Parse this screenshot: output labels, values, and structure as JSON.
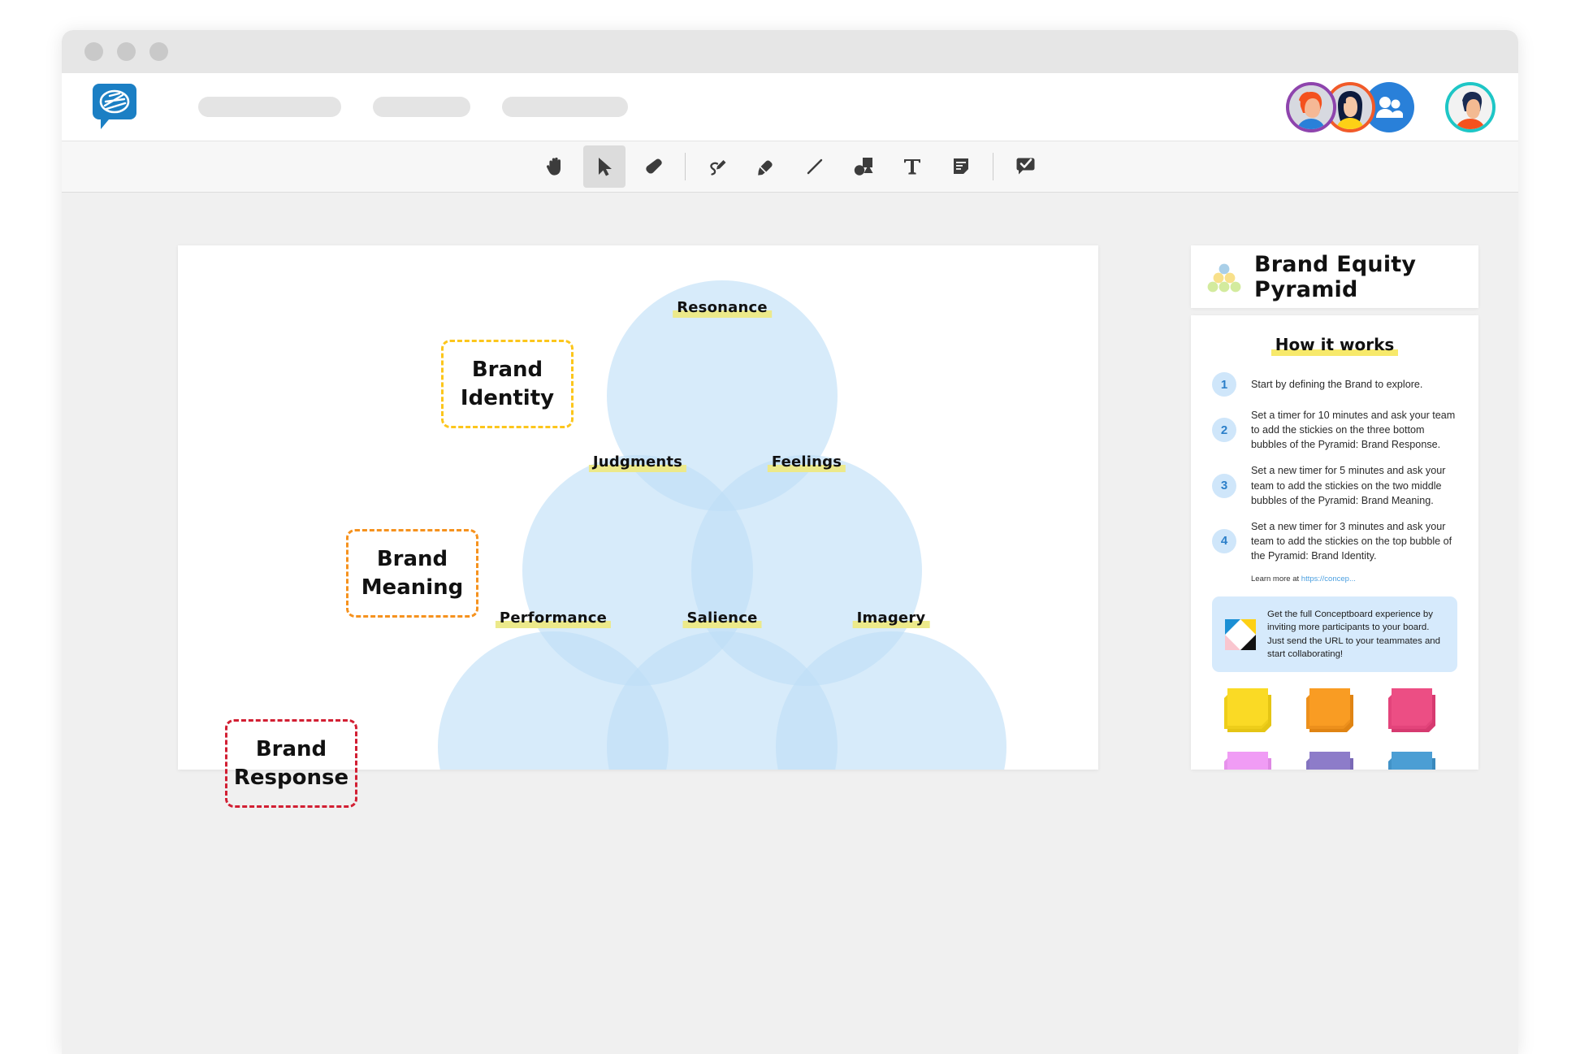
{
  "window": {
    "dots": [
      "dot-red",
      "dot-yellow",
      "dot-green"
    ]
  },
  "header": {
    "logo_name": "conceptboard-logo",
    "placeholder_pills": [
      "",
      "",
      ""
    ],
    "avatars": [
      {
        "name": "avatar-user-1",
        "ring_color": "#8e44ad"
      },
      {
        "name": "avatar-user-2",
        "ring_color": "#f15a29"
      },
      {
        "name": "avatar-group",
        "ring_color": "#2980d9"
      },
      {
        "name": "avatar-current-user",
        "ring_color": "#1ec6c6"
      }
    ]
  },
  "toolbar": {
    "tools": [
      {
        "name": "hand-tool",
        "label": "Hand",
        "selected": false
      },
      {
        "name": "select-tool",
        "label": "Select",
        "selected": true
      },
      {
        "name": "eraser-tool",
        "label": "Eraser",
        "selected": false
      },
      {
        "name": "pen-tool",
        "label": "Pen",
        "selected": false
      },
      {
        "name": "marker-tool",
        "label": "Marker",
        "selected": false
      },
      {
        "name": "line-tool",
        "label": "Line",
        "selected": false
      },
      {
        "name": "shape-tool",
        "label": "Shapes",
        "selected": false
      },
      {
        "name": "text-tool",
        "label": "Text",
        "selected": false
      },
      {
        "name": "note-tool",
        "label": "Sticky Note",
        "selected": false
      },
      {
        "name": "comment-tool",
        "label": "Comment",
        "selected": false
      }
    ]
  },
  "board": {
    "bubbles": [
      {
        "id": "resonance",
        "label": "Resonance"
      },
      {
        "id": "judgments",
        "label": "Judgments"
      },
      {
        "id": "feelings",
        "label": "Feelings"
      },
      {
        "id": "performance",
        "label": "Performance"
      },
      {
        "id": "salience",
        "label": "Salience"
      },
      {
        "id": "imagery",
        "label": "Imagery"
      }
    ],
    "tiers": [
      {
        "id": "brand-identity",
        "line1": "Brand",
        "line2": "Identity",
        "color": "#fcc61c"
      },
      {
        "id": "brand-meaning",
        "line1": "Brand",
        "line2": "Meaning",
        "color": "#f6921e"
      },
      {
        "id": "brand-response",
        "line1": "Brand",
        "line2": "Response",
        "color": "#d21f33"
      }
    ],
    "bubble_fill": "#d6e9fa"
  },
  "panel": {
    "title": "Brand Equity Pyramid",
    "how_it_works_title": "How it works",
    "steps": [
      {
        "number": "1",
        "text": "Start by defining the Brand to explore."
      },
      {
        "number": "2",
        "text": "Set a timer for 10 minutes and ask your team to add the stickies on the three bottom bubbles of the Pyramid: Brand Response."
      },
      {
        "number": "3",
        "text": "Set a new timer for 5 minutes and ask your team to add the stickies on the two middle bubbles of the Pyramid: Brand Meaning."
      },
      {
        "number": "4",
        "text": "Set a new timer for 3 minutes and ask your team to add the stickies on the top bubble of the Pyramid: Brand Identity."
      }
    ],
    "learn_more_prefix": "Learn more at ",
    "learn_more_link": "https://concep...",
    "promo_text": "Get the full Conceptboard experience by inviting more participants to your board. Just send the URL to your teammates and start collaborating!",
    "sticky_colors": [
      {
        "name": "sticky-yellow",
        "face": "#fada25",
        "edge": "#e5c514"
      },
      {
        "name": "sticky-orange",
        "face": "#f99c23",
        "edge": "#e08413"
      },
      {
        "name": "sticky-pink",
        "face": "#ec4e84",
        "edge": "#d63a70"
      },
      {
        "name": "sticky-magenta",
        "face": "#f09cf5",
        "edge": "#de88e3"
      },
      {
        "name": "sticky-purple",
        "face": "#8d7cc9",
        "edge": "#7a69b6"
      },
      {
        "name": "sticky-blue",
        "face": "#4b9ed4",
        "edge": "#3a89bd"
      },
      {
        "name": "sticky-cyan",
        "face": "#3fcbd8",
        "edge": "#2bb5c2"
      },
      {
        "name": "sticky-lightblue",
        "face": "#b5dbf8",
        "edge": "#a0cbec"
      },
      {
        "name": "sticky-lime",
        "face": "#b3dc44",
        "edge": "#9dc732"
      }
    ]
  }
}
